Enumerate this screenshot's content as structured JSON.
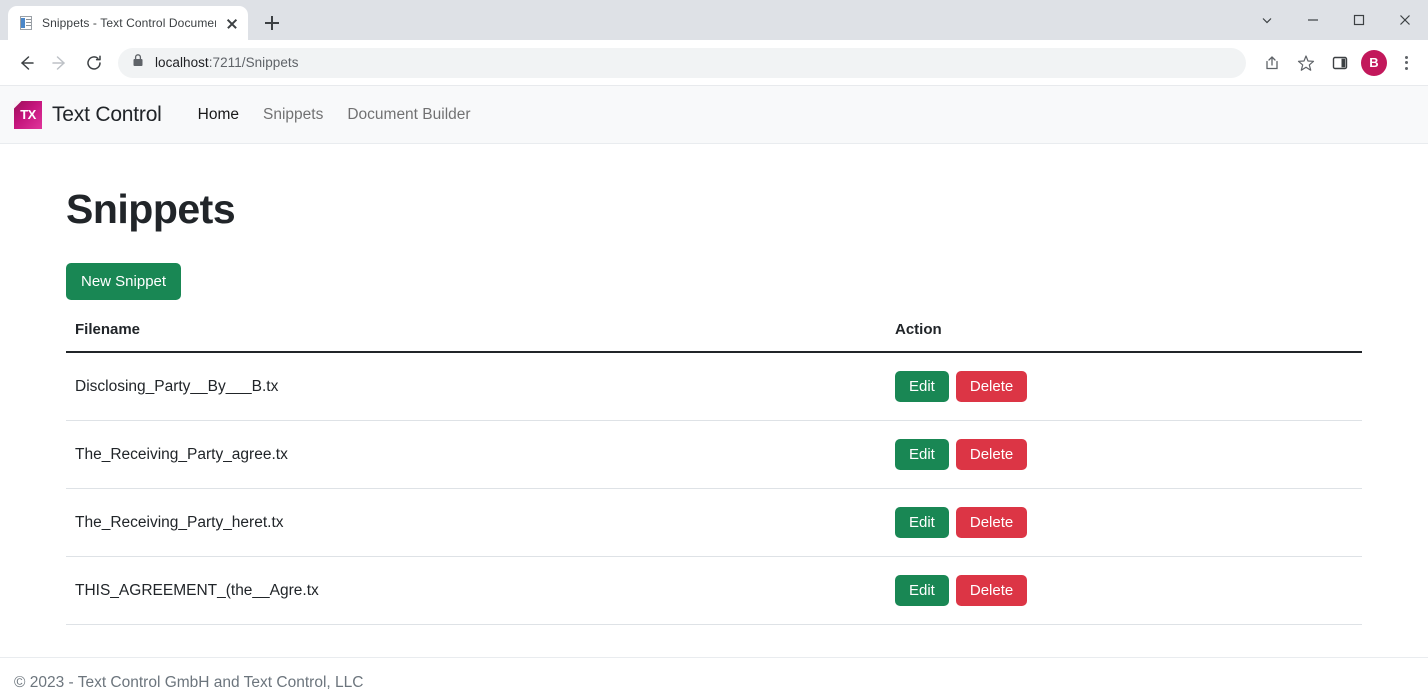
{
  "browser": {
    "tab": {
      "title": "Snippets - Text Control Documen",
      "favicon": "document-icon",
      "close_label": "×"
    },
    "new_tab_label": "+",
    "window_controls": [
      {
        "name": "chevron-down",
        "label": "⌄"
      },
      {
        "name": "minimize",
        "label": "—"
      },
      {
        "name": "maximize",
        "label": "▢"
      },
      {
        "name": "close",
        "label": "✕"
      }
    ],
    "nav": {
      "back_label": "←",
      "forward_label": "→",
      "reload_label": "⟳"
    },
    "omnibox": {
      "lock_icon": "lock-icon",
      "host": "localhost",
      "path": ":7211/Snippets",
      "full_url": "localhost:7211/Snippets"
    },
    "toolbar_icons": [
      {
        "name": "share-icon"
      },
      {
        "name": "bookmark-star-icon"
      },
      {
        "name": "side-panel-icon"
      }
    ],
    "avatar": {
      "initial": "B",
      "color": "#c2185b"
    },
    "menu_label": "⋮"
  },
  "page": {
    "brand": {
      "logo_text": "TX",
      "name": "Text Control"
    },
    "nav_links": [
      {
        "label": "Home",
        "active": true
      },
      {
        "label": "Snippets",
        "active": false
      },
      {
        "label": "Document Builder",
        "active": false
      }
    ],
    "title": "Snippets",
    "new_snippet_button": "New Snippet",
    "table": {
      "headers": {
        "filename": "Filename",
        "action": "Action"
      },
      "rows": [
        {
          "filename": "Disclosing_Party__By___B.tx",
          "edit_label": "Edit",
          "delete_label": "Delete"
        },
        {
          "filename": "The_Receiving_Party_agree.tx",
          "edit_label": "Edit",
          "delete_label": "Delete"
        },
        {
          "filename": "The_Receiving_Party_heret.tx",
          "edit_label": "Edit",
          "delete_label": "Delete"
        },
        {
          "filename": "THIS_AGREEMENT_(the__Agre.tx",
          "edit_label": "Edit",
          "delete_label": "Delete"
        }
      ]
    },
    "footer": "© 2023 - Text Control GmbH and Text Control, LLC"
  },
  "colors": {
    "success": "#198754",
    "danger": "#dc3545",
    "brand_magenta": "#c4157c",
    "navbar_bg": "#f8f9fa"
  }
}
